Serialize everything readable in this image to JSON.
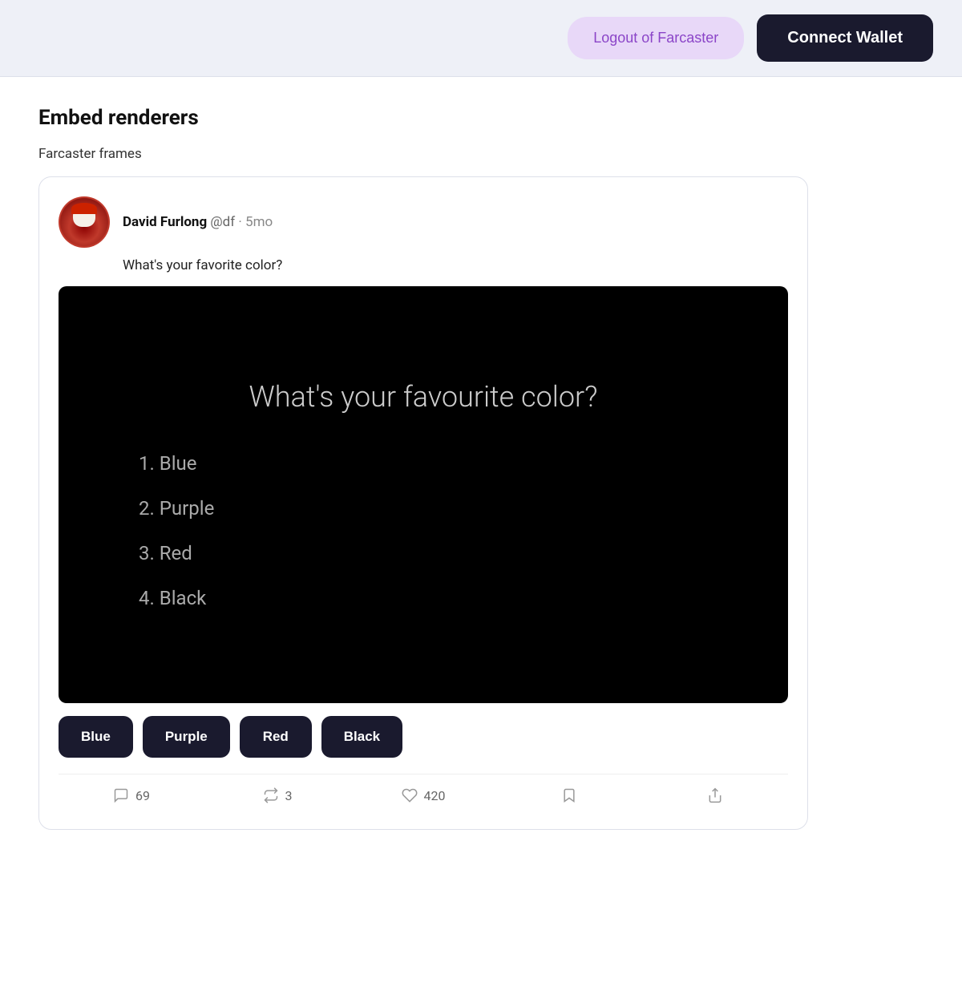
{
  "header": {
    "logout_label": "Logout of Farcaster",
    "connect_label": "Connect Wallet"
  },
  "page": {
    "title": "Embed renderers",
    "section_label": "Farcaster frames"
  },
  "cast": {
    "author_name": "David Furlong",
    "author_handle": "@df",
    "time_ago": "5mo",
    "text": "What's your favorite color?",
    "frame": {
      "title": "What's your favourite color?",
      "options": [
        "1. Blue",
        "2. Purple",
        "3. Red",
        "4. Black"
      ],
      "buttons": [
        "Blue",
        "Purple",
        "Red",
        "Black"
      ]
    },
    "stats": {
      "replies": "69",
      "recasts": "3",
      "likes": "420"
    }
  }
}
